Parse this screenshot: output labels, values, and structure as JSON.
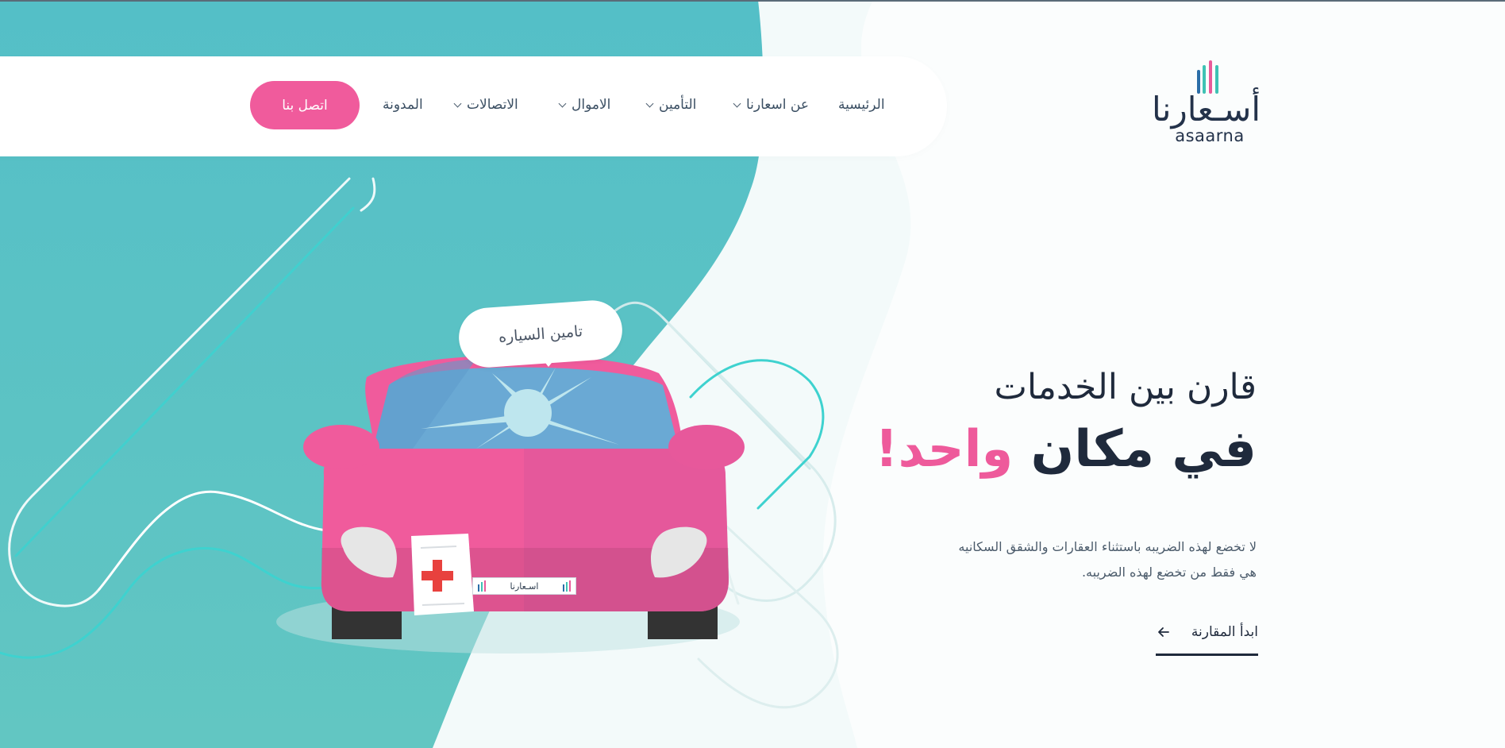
{
  "nav": {
    "items": [
      {
        "label": "الرئيسية",
        "has_dropdown": false
      },
      {
        "label": "عن اسعارنا",
        "has_dropdown": true
      },
      {
        "label": "التأمين",
        "has_dropdown": true
      },
      {
        "label": "الاموال",
        "has_dropdown": true
      },
      {
        "label": "الاتصالات",
        "has_dropdown": true
      },
      {
        "label": "المدونة",
        "has_dropdown": false
      }
    ],
    "cta_label": "اتصل بنا"
  },
  "logo": {
    "arabic": "أسـعارنا",
    "latin": "asaarna"
  },
  "hero": {
    "line1": "قارن بين الخدمات",
    "line2_dark": "في مكان",
    "line2_pink": "واحد!",
    "description_line1": "لا تخضع لهذه الضريبه باستثناء العقارات والشقق السكانيه",
    "description_line2": "هي فقط من تخضع لهذه الضريبه.",
    "start_label": "ابدأ المقارنة",
    "start_icon": "arrow-left-icon"
  },
  "illustration": {
    "bubble_text": "تامين السياره",
    "plate_text": "اسـعارنا"
  },
  "colors": {
    "teal": "#55c0c4",
    "pink": "#f05b9c",
    "navy": "#1f2a3c",
    "logo_bar_blue": "#2b6ea8",
    "logo_bar_teal": "#3fc2b4"
  }
}
